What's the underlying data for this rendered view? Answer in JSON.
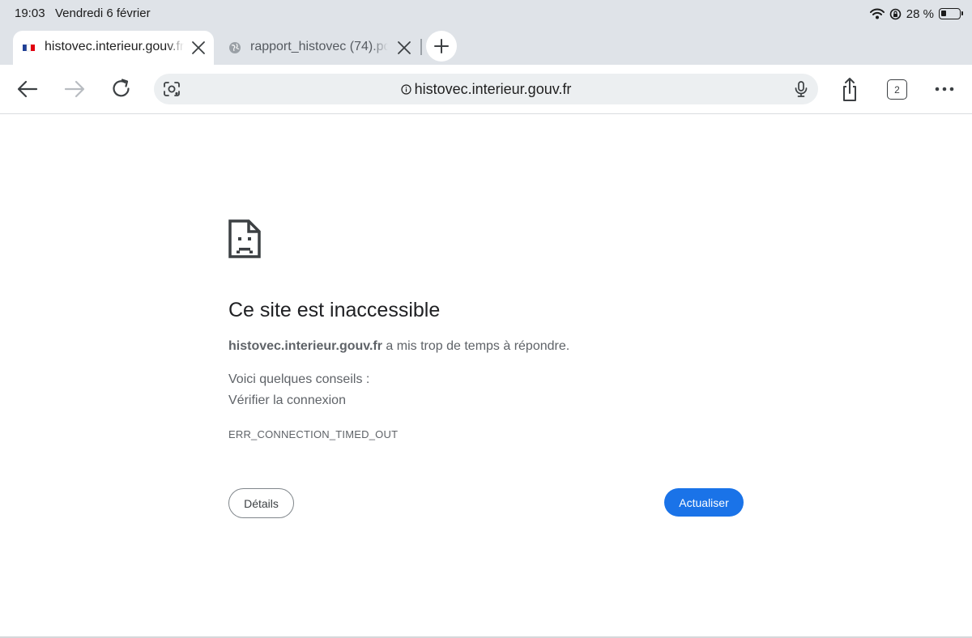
{
  "status_bar": {
    "time": "19:03",
    "date": "Vendredi 6 février",
    "battery_text": "28 %",
    "battery_level": 0.28,
    "icons": [
      "wifi-icon",
      "orientation-lock-icon",
      "battery-icon"
    ]
  },
  "tabs": [
    {
      "title": "histovec.interieur.gouv.fr",
      "active": true,
      "favicon": "french-flag-icon",
      "close_icon": "close-icon"
    },
    {
      "title": "rapport_histovec (74).pdf",
      "active": false,
      "favicon": "globe-icon",
      "close_icon": "close-icon"
    }
  ],
  "new_tab_icon": "plus-icon",
  "toolbar": {
    "back_icon": "back-arrow-icon",
    "forward_icon": "forward-arrow-icon",
    "reload_icon": "reload-icon",
    "lens_icon": "google-lens-icon",
    "url": "histovec.interieur.gouv.fr",
    "site_info_icon": "info-icon",
    "mic_icon": "microphone-icon",
    "share_icon": "share-icon",
    "tab_count": "2",
    "menu_icon": "more-horizontal-icon"
  },
  "error_page": {
    "icon": "sad-document-icon",
    "title": "Ce site est inaccessible",
    "host": "histovec.interieur.gouv.fr",
    "message": " a mis trop de temps à répondre.",
    "tips_label": "Voici quelques conseils :",
    "tips": [
      "Vérifier la connexion"
    ],
    "error_code": "ERR_CONNECTION_TIMED_OUT",
    "details_button": "Détails",
    "reload_button": "Actualiser"
  },
  "colors": {
    "accent": "#1a73e8",
    "status_bar_bg": "#dfe3e8",
    "omnibox_bg": "#eceff1",
    "text_primary": "#202124",
    "text_secondary": "#5f6368"
  }
}
